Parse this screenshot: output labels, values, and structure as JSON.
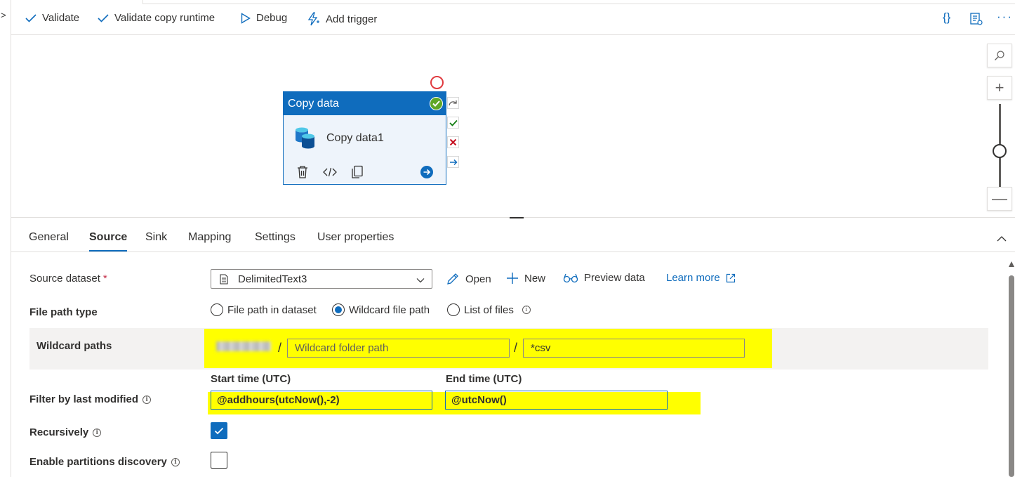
{
  "toolbar": {
    "validate": "Validate",
    "validate_copy_runtime": "Validate copy runtime",
    "debug": "Debug",
    "add_trigger": "Add trigger",
    "code_glyph": "{}"
  },
  "activity": {
    "type": "Copy data",
    "name": "Copy data1"
  },
  "tabs": [
    "General",
    "Source",
    "Sink",
    "Mapping",
    "Settings",
    "User properties"
  ],
  "active_tab": "Source",
  "source": {
    "dataset_label": "Source dataset",
    "required_mark": "*",
    "dataset_value": "DelimitedText3",
    "open": "Open",
    "new": "New",
    "preview_data": "Preview data",
    "learn_more": "Learn more",
    "file_path_type_label": "File path type",
    "file_path_options": [
      "File path in dataset",
      "Wildcard file path",
      "List of files"
    ],
    "file_path_selected": "Wildcard file path",
    "wildcard_label": "Wildcard paths",
    "slash": "/",
    "wildcard_folder_placeholder": "Wildcard folder path",
    "wildcard_file_value": "*csv",
    "start_time_label": "Start time (UTC)",
    "end_time_label": "End time (UTC)",
    "filter_label": "Filter by last modified",
    "start_time_value": "@addhours(utcNow(),-2)",
    "end_time_value": "@utcNow()",
    "recursively_label": "Recursively",
    "recursively_checked": true,
    "partitions_label": "Enable partitions discovery",
    "partitions_checked": false
  },
  "colors": {
    "accent": "#0f6cbd",
    "highlight": "#ffff00",
    "success": "#5fa726",
    "error": "#e0393e"
  }
}
